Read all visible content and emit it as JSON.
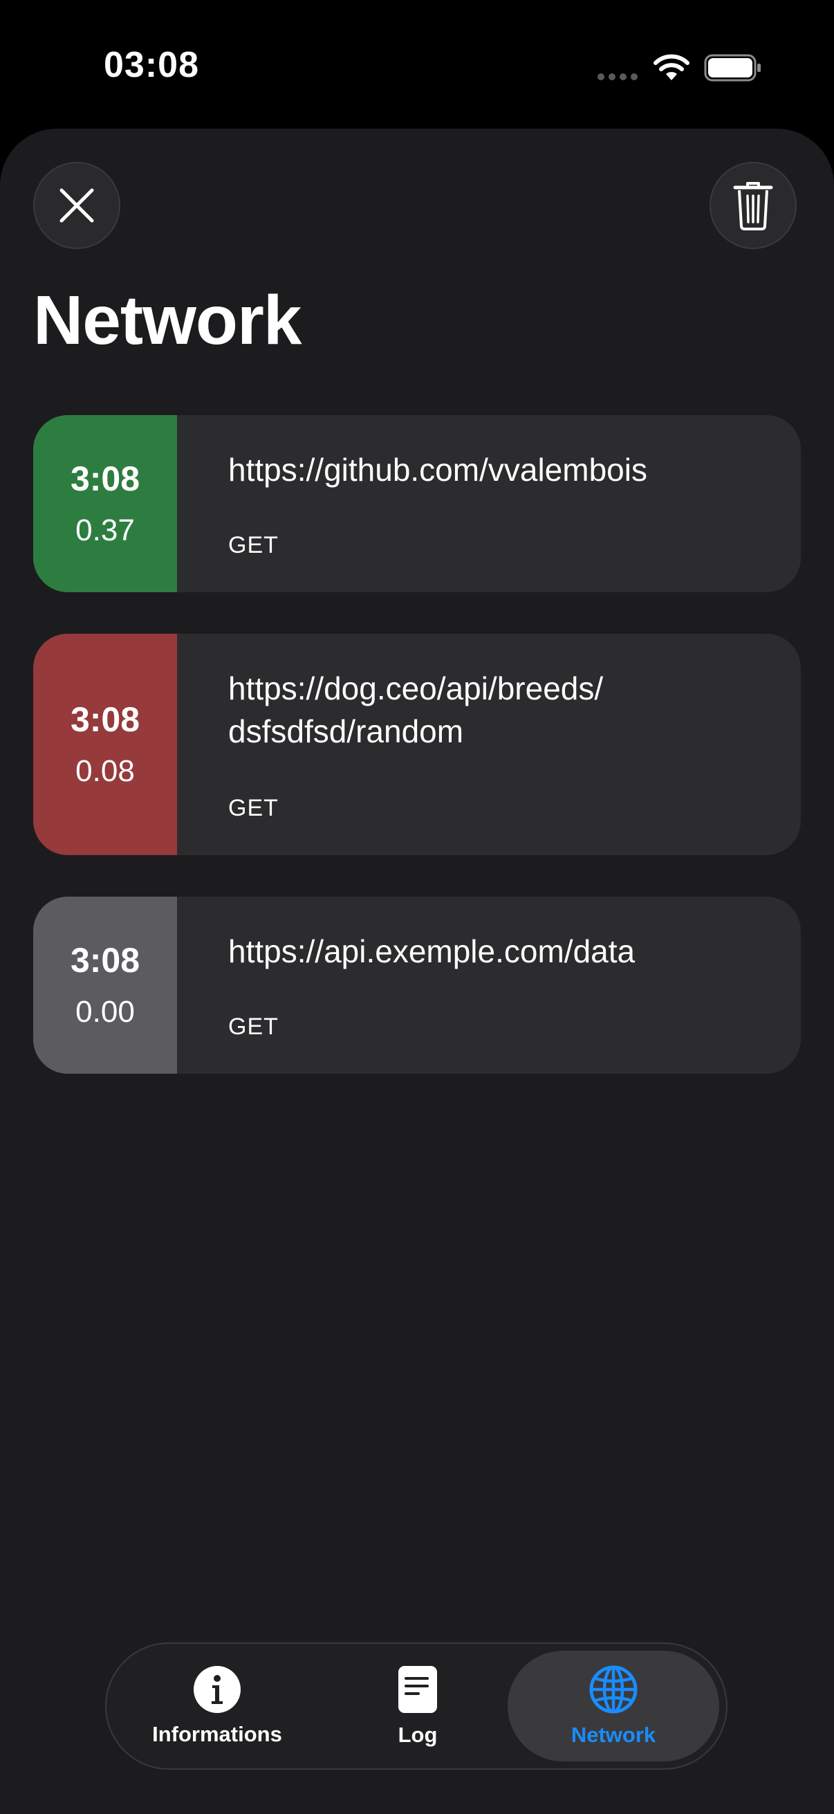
{
  "status_bar": {
    "time": "03:08"
  },
  "header": {
    "title": "Network"
  },
  "requests": [
    {
      "time": "3:08",
      "duration": "0.37",
      "url": "https://github.com/vvalembois",
      "method": "GET",
      "status_color": "#2e7d40"
    },
    {
      "time": "3:08",
      "duration": "0.08",
      "url_line1": "https://dog.ceo/api/breeds/",
      "url_line2": "dsfsdfsd/random",
      "method": "GET",
      "status_color": "#963a3c"
    },
    {
      "time": "3:08",
      "duration": "0.00",
      "url": "https://api.exemple.com/data",
      "method": "GET",
      "status_color": "#5c5c60"
    }
  ],
  "tab_bar": {
    "tabs": [
      {
        "label": "Informations",
        "icon": "info-icon"
      },
      {
        "label": "Log",
        "icon": "document-icon"
      },
      {
        "label": "Network",
        "icon": "globe-icon",
        "selected": true
      }
    ]
  },
  "colors": {
    "accent": "#1a8cff",
    "background": "#1c1c1e",
    "card": "#2c2c2e"
  }
}
